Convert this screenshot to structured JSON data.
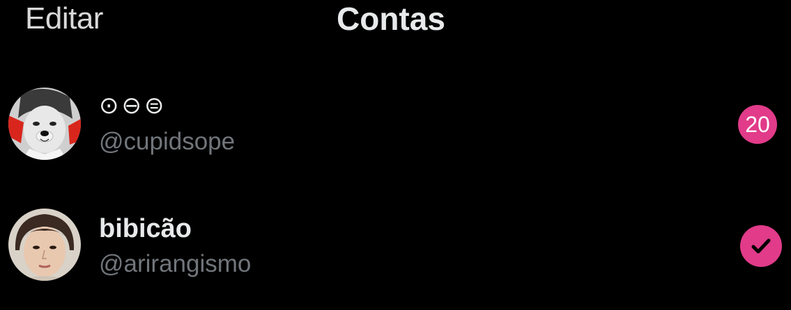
{
  "header": {
    "edit_label": "Editar",
    "title": "Contas"
  },
  "accounts": [
    {
      "display_name": "⊙⊖⊜",
      "handle": "@cupidsope",
      "badge_count": "20",
      "avatar_icon": "dog-filter-avatar"
    },
    {
      "display_name": "bibicão",
      "handle": "@arirangismo",
      "selected": true,
      "avatar_icon": "portrait-avatar"
    }
  ],
  "colors": {
    "background": "#000000",
    "accent": "#e13b8a",
    "primary_text": "#e7e9ea",
    "secondary_text": "#71767b"
  }
}
